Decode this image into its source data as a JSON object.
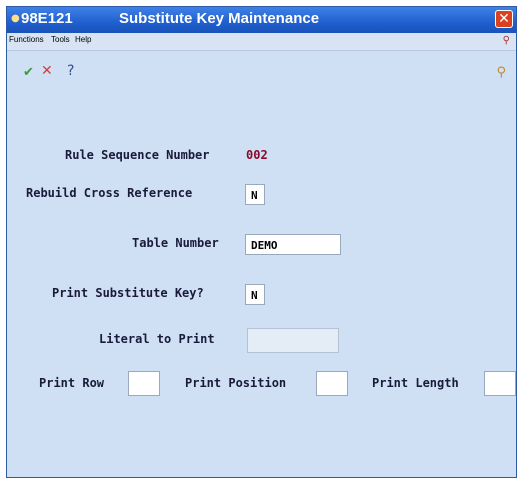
{
  "window": {
    "code": "98E121",
    "title": "Substitute Key Maintenance"
  },
  "menu": {
    "items": [
      "Functions",
      "Tools",
      "Help"
    ]
  },
  "icons": {
    "ok": "checkmark-icon",
    "cancel": "cancel-icon",
    "help": "help-icon",
    "find": "search-icon"
  },
  "form": {
    "rule_sequence_label": "Rule Sequence Number",
    "rule_sequence_value": "002",
    "rebuild_label": "Rebuild Cross Reference",
    "rebuild_value": "N",
    "table_number_label": "Table Number",
    "table_number_value": "DEMO",
    "print_key_label": "Print Substitute Key?",
    "print_key_value": "N",
    "literal_label": "Literal to Print",
    "literal_value": "",
    "print_row_label": "Print Row",
    "print_row_value": "",
    "print_position_label": "Print Position",
    "print_position_value": "",
    "print_length_label": "Print Length",
    "print_length_value": ""
  },
  "colors": {
    "titlebar": "#1f5fcf",
    "form_bg": "#cfe0f4",
    "value_red": "#8b0a2a"
  }
}
